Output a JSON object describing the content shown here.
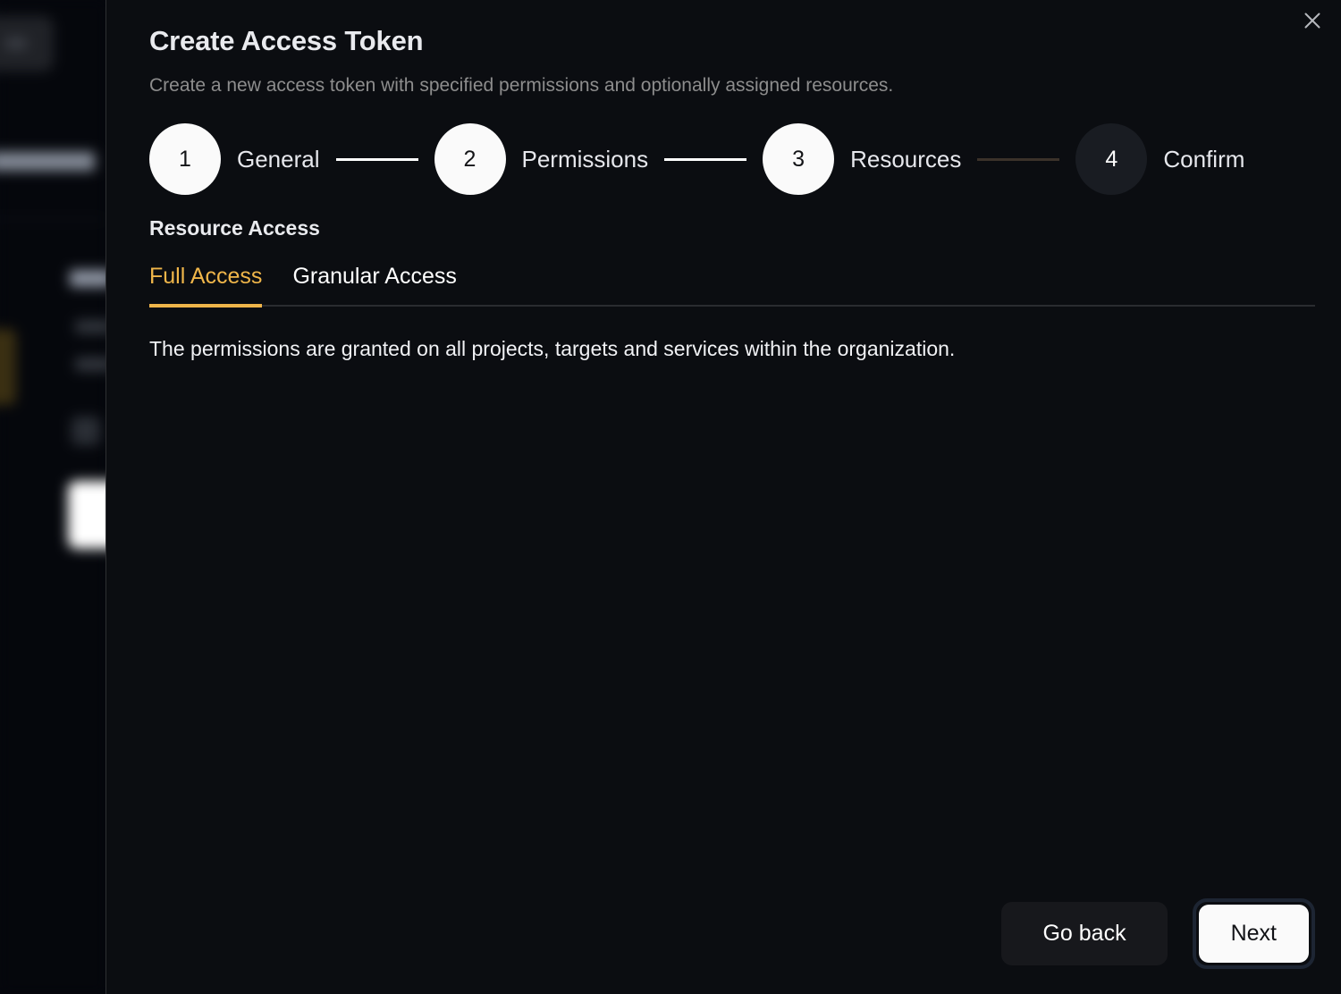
{
  "dialog": {
    "title": "Create Access Token",
    "description": "Create a new access token with specified permissions and optionally assigned resources.",
    "close_icon": "close-icon"
  },
  "stepper": {
    "steps": [
      {
        "number": "1",
        "label": "General",
        "state": "done"
      },
      {
        "number": "2",
        "label": "Permissions",
        "state": "done"
      },
      {
        "number": "3",
        "label": "Resources",
        "state": "done"
      },
      {
        "number": "4",
        "label": "Confirm",
        "state": "todo"
      }
    ]
  },
  "section": {
    "title": "Resource Access",
    "tabs": [
      {
        "label": "Full Access",
        "active": true
      },
      {
        "label": "Granular Access",
        "active": false
      }
    ],
    "body_text": "The permissions are granted on all projects, targets and services within the organization."
  },
  "footer": {
    "go_back_label": "Go back",
    "next_label": "Next"
  },
  "colors": {
    "accent_amber": "#efb54a",
    "modal_bg": "#0b0d11",
    "text_primary": "#e9eaee",
    "text_muted": "#8d8d8d",
    "focus_ring": "#1d2533"
  }
}
